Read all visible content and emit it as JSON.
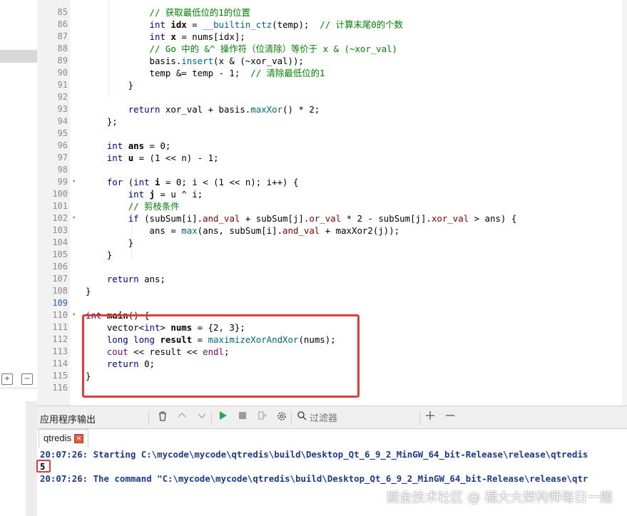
{
  "editor": {
    "lines": [
      {
        "n": "85",
        "t": [
          [
            "cmt",
            "            // 获取最低位的1的位置"
          ]
        ]
      },
      {
        "n": "86",
        "t": [
          [
            "",
            "            "
          ],
          [
            "kw",
            "int"
          ],
          [
            "",
            " "
          ],
          [
            "bold",
            "idx"
          ],
          [
            "",
            " = "
          ],
          [
            "fn",
            "__builtin_ctz"
          ],
          [
            "",
            "(temp);  "
          ],
          [
            "cmt",
            "// 计算末尾0的个数"
          ]
        ]
      },
      {
        "n": "87",
        "t": [
          [
            "",
            "            "
          ],
          [
            "kw",
            "int"
          ],
          [
            "",
            " "
          ],
          [
            "bold",
            "x"
          ],
          [
            "",
            " = nums[idx];"
          ]
        ]
      },
      {
        "n": "88",
        "t": [
          [
            "cmt",
            "            // Go 中的 &^ 操作符（位清除）等价于 x & (~xor_val)"
          ]
        ]
      },
      {
        "n": "89",
        "t": [
          [
            "",
            "            basis."
          ],
          [
            "fn",
            "insert"
          ],
          [
            "",
            "(x & (~xor_val));"
          ]
        ]
      },
      {
        "n": "90",
        "t": [
          [
            "",
            "            temp &= temp - 1;  "
          ],
          [
            "cmt",
            "// 清除最低位的1"
          ]
        ]
      },
      {
        "n": "91",
        "t": [
          [
            "",
            "        }"
          ]
        ]
      },
      {
        "n": "92",
        "t": [
          [
            "",
            ""
          ]
        ]
      },
      {
        "n": "93",
        "t": [
          [
            "",
            "        "
          ],
          [
            "kw",
            "return"
          ],
          [
            "",
            " xor_val + basis."
          ],
          [
            "fn",
            "maxXor"
          ],
          [
            "",
            "() * 2;"
          ]
        ]
      },
      {
        "n": "94",
        "t": [
          [
            "",
            "    };"
          ]
        ]
      },
      {
        "n": "95",
        "t": [
          [
            "",
            ""
          ]
        ]
      },
      {
        "n": "96",
        "t": [
          [
            "",
            "    "
          ],
          [
            "kw",
            "int"
          ],
          [
            "",
            " "
          ],
          [
            "bold",
            "ans"
          ],
          [
            "",
            " = 0;"
          ]
        ]
      },
      {
        "n": "97",
        "t": [
          [
            "",
            "    "
          ],
          [
            "kw",
            "int"
          ],
          [
            "",
            " "
          ],
          [
            "bold",
            "u"
          ],
          [
            "",
            " = (1 << n) - 1;"
          ]
        ]
      },
      {
        "n": "98",
        "t": [
          [
            "",
            ""
          ]
        ]
      },
      {
        "n": "99",
        "fold": "▾",
        "t": [
          [
            "",
            "    "
          ],
          [
            "kw",
            "for"
          ],
          [
            "",
            " ("
          ],
          [
            "kw",
            "int"
          ],
          [
            "",
            " "
          ],
          [
            "bold",
            "i"
          ],
          [
            "",
            " = 0; i < (1 << n); i++) {"
          ]
        ]
      },
      {
        "n": "100",
        "t": [
          [
            "",
            "        "
          ],
          [
            "kw",
            "int"
          ],
          [
            "",
            " "
          ],
          [
            "bold",
            "j"
          ],
          [
            "",
            " = u ^ i;"
          ]
        ]
      },
      {
        "n": "101",
        "t": [
          [
            "cmt",
            "        // 剪枝条件"
          ]
        ]
      },
      {
        "n": "102",
        "fold": "▾",
        "t": [
          [
            "",
            "        "
          ],
          [
            "kw",
            "if"
          ],
          [
            "",
            " (subSum[i]."
          ],
          [
            "fld",
            "and_val"
          ],
          [
            "",
            " + subSum[j]."
          ],
          [
            "fld",
            "or_val"
          ],
          [
            "",
            " * 2 - subSum[j]."
          ],
          [
            "fld",
            "xor_val"
          ],
          [
            "",
            " > ans) {"
          ]
        ]
      },
      {
        "n": "103",
        "t": [
          [
            "",
            "            ans = "
          ],
          [
            "fn",
            "max"
          ],
          [
            "",
            "(ans, subSum[i]."
          ],
          [
            "fld",
            "and_val"
          ],
          [
            "",
            " + maxXor2(j));"
          ]
        ]
      },
      {
        "n": "104",
        "t": [
          [
            "",
            "        }"
          ]
        ]
      },
      {
        "n": "105",
        "t": [
          [
            "",
            "    }"
          ]
        ]
      },
      {
        "n": "106",
        "t": [
          [
            "",
            ""
          ]
        ]
      },
      {
        "n": "107",
        "t": [
          [
            "",
            "    "
          ],
          [
            "kw",
            "return"
          ],
          [
            "",
            " ans;"
          ]
        ]
      },
      {
        "n": "108",
        "t": [
          [
            "",
            "}"
          ]
        ]
      },
      {
        "n": "109",
        "cur": true,
        "t": [
          [
            "",
            ""
          ]
        ]
      },
      {
        "n": "110",
        "fold": "▾",
        "t": [
          [
            "kw",
            "int"
          ],
          [
            "",
            " "
          ],
          [
            "bold",
            "main"
          ],
          [
            "",
            "() {"
          ]
        ]
      },
      {
        "n": "111",
        "t": [
          [
            "",
            "    vector<"
          ],
          [
            "kw",
            "int"
          ],
          [
            "",
            "> "
          ],
          [
            "bold",
            "nums"
          ],
          [
            "",
            " = {2, 3};"
          ]
        ]
      },
      {
        "n": "112",
        "t": [
          [
            "",
            "    "
          ],
          [
            "kw",
            "long long"
          ],
          [
            "",
            " "
          ],
          [
            "bold",
            "result"
          ],
          [
            "",
            " = "
          ],
          [
            "fn",
            "maximizeXorAndXor"
          ],
          [
            "",
            "(nums);"
          ]
        ]
      },
      {
        "n": "113",
        "t": [
          [
            "",
            "    "
          ],
          [
            "tmpl",
            "cout"
          ],
          [
            "",
            " << result << "
          ],
          [
            "tmpl",
            "endl"
          ],
          [
            "",
            ";"
          ]
        ]
      },
      {
        "n": "114",
        "t": [
          [
            "",
            "    "
          ],
          [
            "kw",
            "return"
          ],
          [
            "",
            " 0;"
          ]
        ]
      },
      {
        "n": "115",
        "t": [
          [
            "",
            "}"
          ]
        ]
      },
      {
        "n": "116",
        "t": [
          [
            "",
            ""
          ]
        ]
      }
    ]
  },
  "output_panel": {
    "title": "应用程序输出",
    "filter_placeholder": "过滤器",
    "tab_label": "qtredis",
    "tab_close": "✕",
    "lines": [
      "20:07:26: Starting C:\\mycode\\mycode\\qtredis\\build\\Desktop_Qt_6_9_2_MinGW_64_bit-Release\\release\\qtredis",
      "5",
      "20:07:26: The command \"C:\\mycode\\mycode\\qtredis\\build\\Desktop_Qt_6_9_2_MinGW_64_bit-Release\\release\\qtr"
    ]
  },
  "toolbar_icons": [
    "trash-icon",
    "up-arrow-icon",
    "down-arrow-icon",
    "run-icon",
    "stop-icon",
    "attach-icon",
    "settings-icon",
    "search-icon",
    "plus-icon",
    "minus-icon"
  ],
  "left_panel": {
    "expand": "+",
    "collapse": "−"
  },
  "watermark": "掘金技术社区 @ 福大大架构师每日一题",
  "colors": {
    "highlight": "#e03c3c",
    "keyword": "#00008b",
    "comment": "#008000",
    "output_text": "#1a3a8c"
  }
}
